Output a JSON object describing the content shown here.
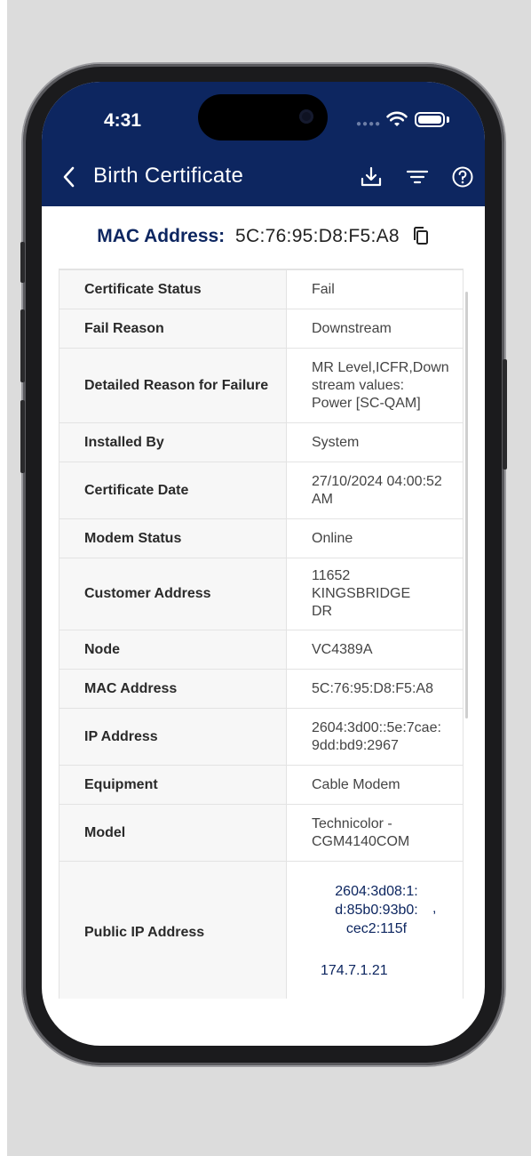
{
  "status_bar": {
    "time": "4:31"
  },
  "header": {
    "title": "Birth Certificate"
  },
  "mac_header": {
    "label": "MAC Address:",
    "value": "5C:76:95:D8:F5:A8"
  },
  "rows": [
    {
      "key": "Certificate Status",
      "value": "Fail"
    },
    {
      "key": "Fail Reason",
      "value": "Downstream"
    },
    {
      "key": "Detailed Reason for Failure",
      "value_lines": [
        "MR Level,ICFR,Down",
        "stream values:",
        "Power [SC-QAM]"
      ]
    },
    {
      "key": "Installed By",
      "value": "System"
    },
    {
      "key": "Certificate Date",
      "value_lines": [
        "27/10/2024 04:00:52",
        "AM"
      ]
    },
    {
      "key": "Modem Status",
      "value": "Online"
    },
    {
      "key": "Customer Address",
      "value_lines": [
        "11652 KINGSBRIDGE",
        "DR"
      ]
    },
    {
      "key": "Node",
      "value": "VC4389A"
    },
    {
      "key": "MAC Address",
      "value": "5C:76:95:D8:F5:A8"
    },
    {
      "key": "IP Address",
      "value_lines": [
        "2604:3d00::5e:7cae:",
        "9dd:bd9:2967"
      ]
    },
    {
      "key": "Equipment",
      "value": "Cable Modem"
    },
    {
      "key": "Model",
      "value_lines": [
        "Technicolor -",
        "CGM4140COM"
      ]
    },
    {
      "key": "Public IP Address",
      "ipv6_lines": [
        "2604:3d08:1:",
        "d:85b0:93b0:",
        "cec2:115f"
      ],
      "separator": ",",
      "ipv4": "174.7.1.21"
    }
  ],
  "colors": {
    "header": "#0d2660",
    "fail": "#e53232",
    "online": "#1fbf2a"
  },
  "icons": [
    "back-arrow-icon",
    "download-icon",
    "filter-icon",
    "help-icon",
    "copy-icon",
    "wifi-icon",
    "battery-icon"
  ]
}
